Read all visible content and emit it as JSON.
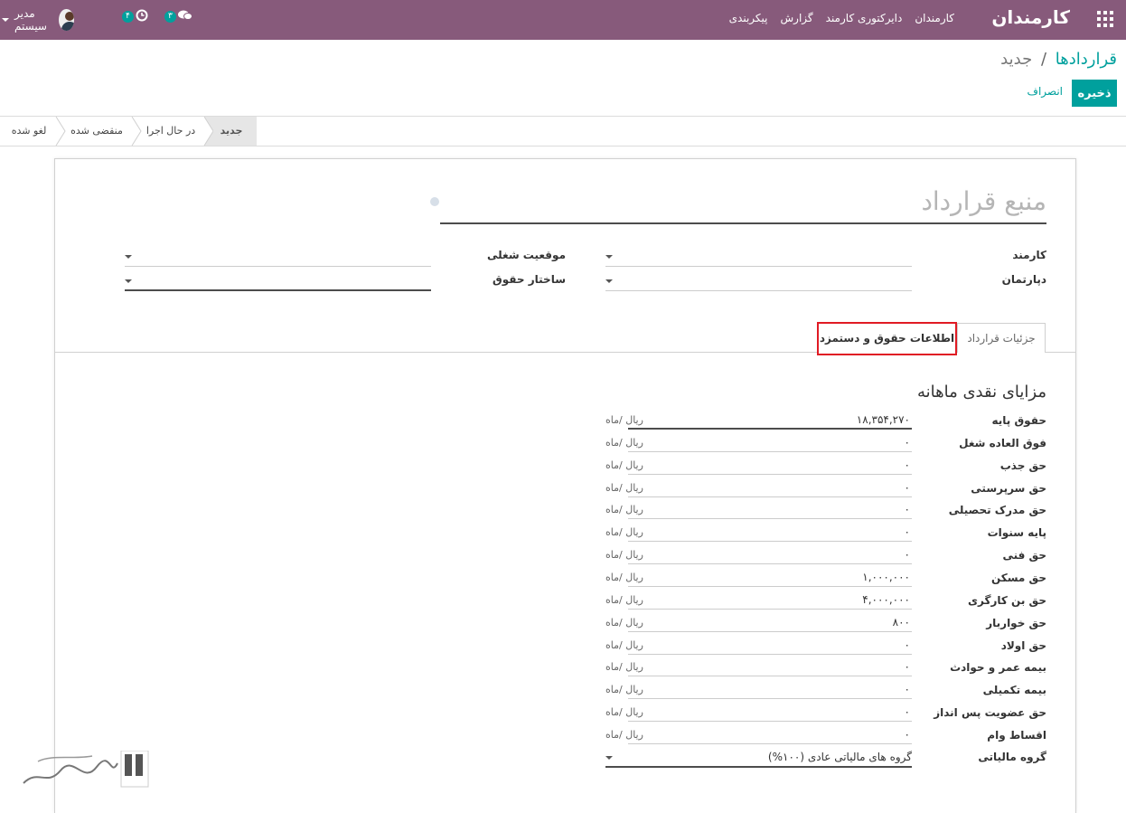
{
  "navbar": {
    "app_title": "کارمندان",
    "menu": [
      "کارمندان",
      "دایرکتوری کارمند",
      "گزارش",
      "پیکربندی"
    ],
    "user_name": "مدیر سیستم",
    "messages_count": "۳",
    "activities_count": "۴"
  },
  "breadcrumb": {
    "parent": "قراردادها",
    "separator": "/",
    "current": "جدید"
  },
  "buttons": {
    "save": "ذخیره",
    "discard": "انصراف"
  },
  "stages": [
    "جدید",
    "در حال اجرا",
    "منقضی شده",
    "لغو شده"
  ],
  "active_stage": "جدید",
  "form": {
    "name_placeholder": "منبع قرارداد",
    "fields": {
      "employee": "کارمند",
      "department": "دپارتمان",
      "job_position": "موقعیت شغلی",
      "salary_structure": "ساختار حقوق"
    },
    "tabs": [
      "جزئیات قرارداد",
      "اطلاعات حقوق و دستمزد"
    ],
    "active_tab": "اطلاعات حقوق و دستمزد",
    "section_title": "مزایای نقدی ماهانه",
    "unit": "ریال /ماه",
    "rows": [
      {
        "label": "حقوق پایه",
        "value": "۱۸,۳۵۴,۲۷۰"
      },
      {
        "label": "فوق العاده شغل",
        "value": "۰"
      },
      {
        "label": "حق جذب",
        "value": "۰"
      },
      {
        "label": "حق سرپرستی",
        "value": "۰"
      },
      {
        "label": "حق مدرک تحصیلی",
        "value": "۰"
      },
      {
        "label": "پایه سنوات",
        "value": "۰"
      },
      {
        "label": "حق فنی",
        "value": "۰"
      },
      {
        "label": "حق مسکن",
        "value": "۱,۰۰۰,۰۰۰"
      },
      {
        "label": "حق بن کارگری",
        "value": "۴,۰۰۰,۰۰۰"
      },
      {
        "label": "حق خواربار",
        "value": "۸۰۰"
      },
      {
        "label": "حق اولاد",
        "value": "۰"
      },
      {
        "label": "بیمه عمر و حوادث",
        "value": "۰"
      },
      {
        "label": "بیمه تکمیلی",
        "value": "۰"
      },
      {
        "label": "حق عضویت پس انداز",
        "value": "۰"
      },
      {
        "label": "اقساط وام",
        "value": "۰"
      }
    ],
    "tax_group_label": "گروه مالیاتی",
    "tax_group_value": "گروه های مالیاتی عادی (۱۰۰%)"
  },
  "colors": {
    "navbar": "#875a7b",
    "accent": "#00a09d",
    "highlight": "#e01b24"
  }
}
